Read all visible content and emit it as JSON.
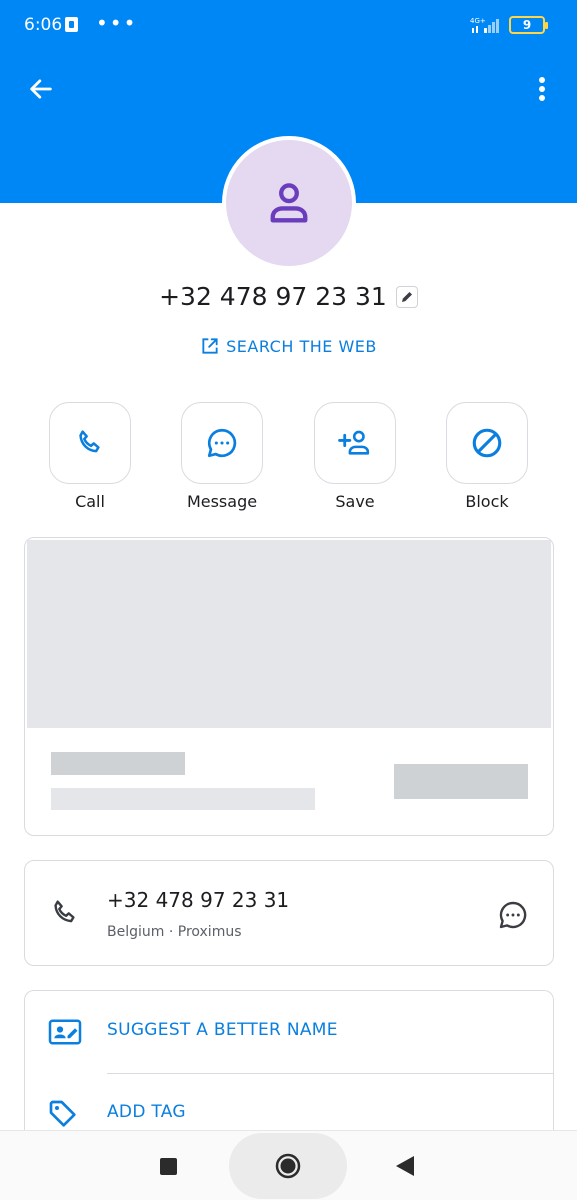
{
  "status_bar": {
    "time": "6:06",
    "more": "•••",
    "battery": "9"
  },
  "contact": {
    "phone": "+32 478 97 23 31",
    "search_web_label": "SEARCH THE WEB"
  },
  "actions": [
    {
      "label": "Call"
    },
    {
      "label": "Message"
    },
    {
      "label": "Save"
    },
    {
      "label": "Block"
    }
  ],
  "number_card": {
    "number": "+32 478 97 23 31",
    "details": "Belgium · Proximus"
  },
  "options": {
    "suggest_name": "SUGGEST A BETTER NAME",
    "add_tag": "ADD TAG"
  },
  "colors": {
    "header": "#0087f6",
    "accent": "#0a7fdf",
    "avatar_bg": "#e4d9f1",
    "avatar_icon": "#6a3dbd"
  }
}
